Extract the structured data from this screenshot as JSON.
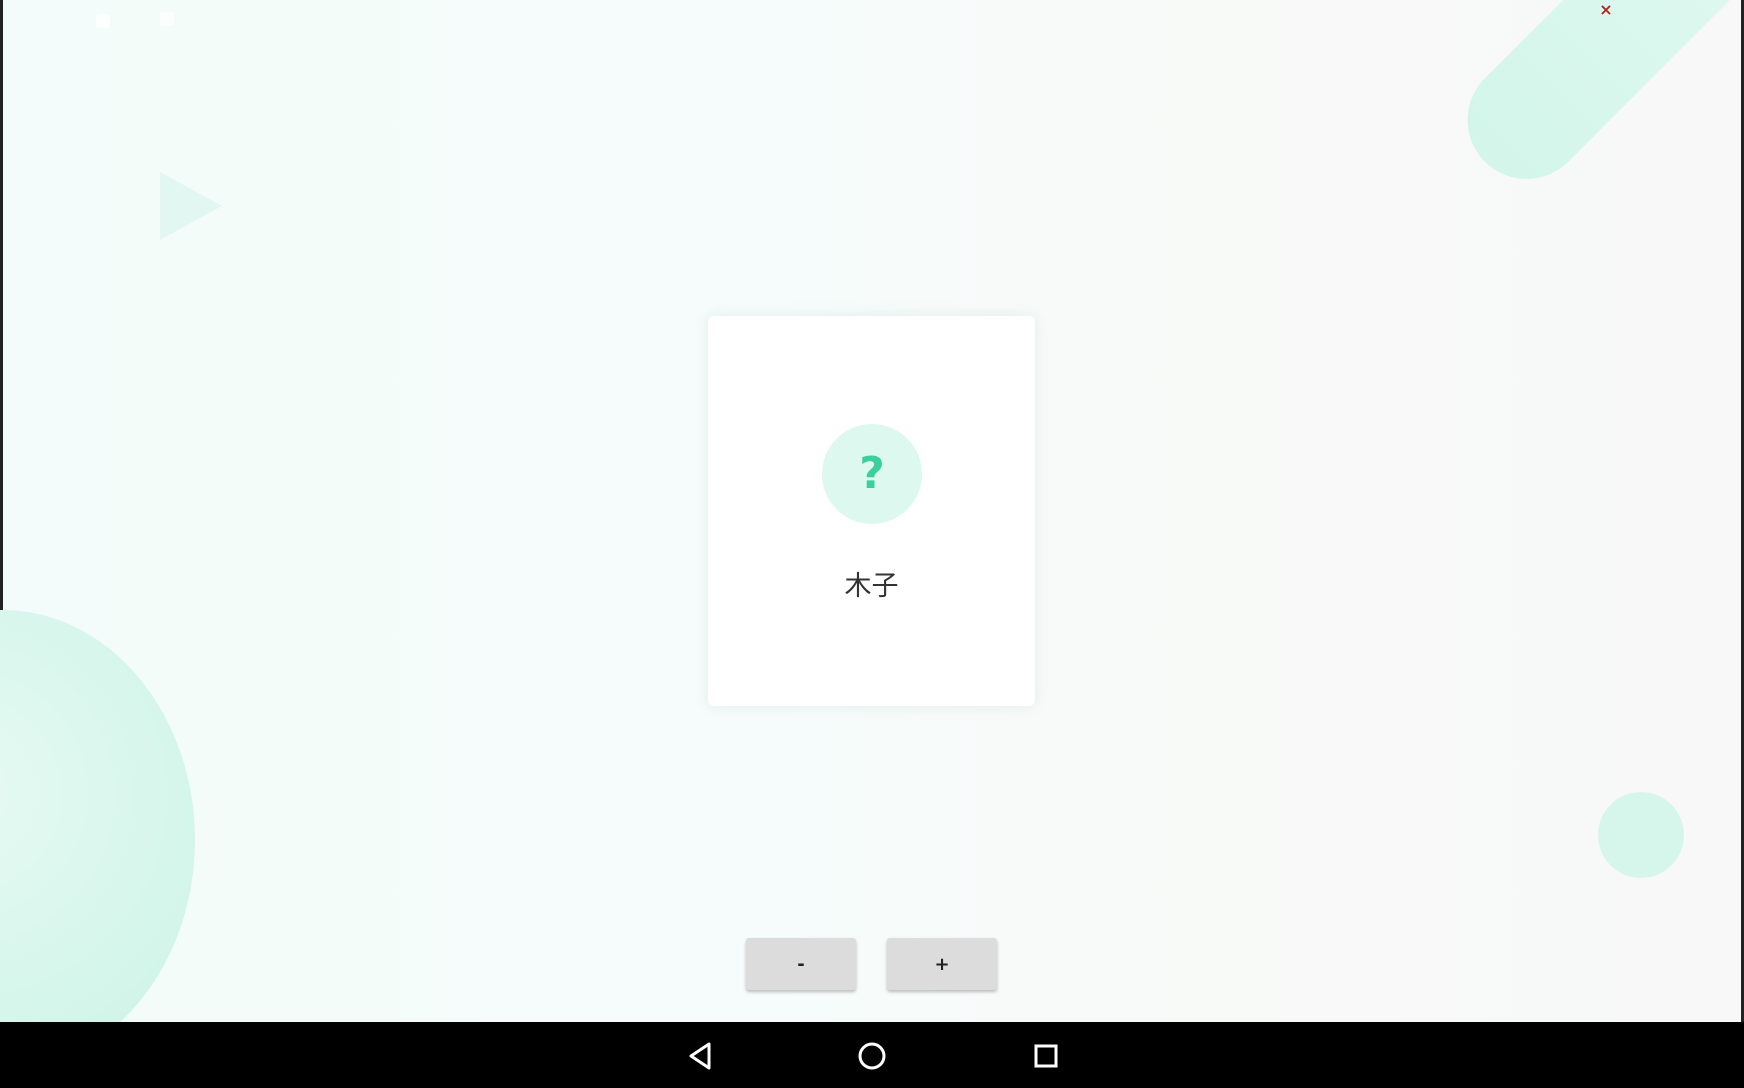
{
  "overlay": {
    "close_label": "×"
  },
  "card": {
    "icon": "question-mark-icon",
    "icon_glyph": "?",
    "name": "木子"
  },
  "controls": {
    "minus_label": "-",
    "plus_label": "+"
  },
  "navigation_bar": {
    "buttons": [
      "back-icon",
      "home-icon",
      "recent-apps-icon"
    ]
  },
  "colors": {
    "accent": "#3ccf9d",
    "badge_bg": "#dcf8ef",
    "decor_mint": "#d3f5ea",
    "close_red": "#b3261e",
    "button_bg": "#dcdcdc"
  }
}
